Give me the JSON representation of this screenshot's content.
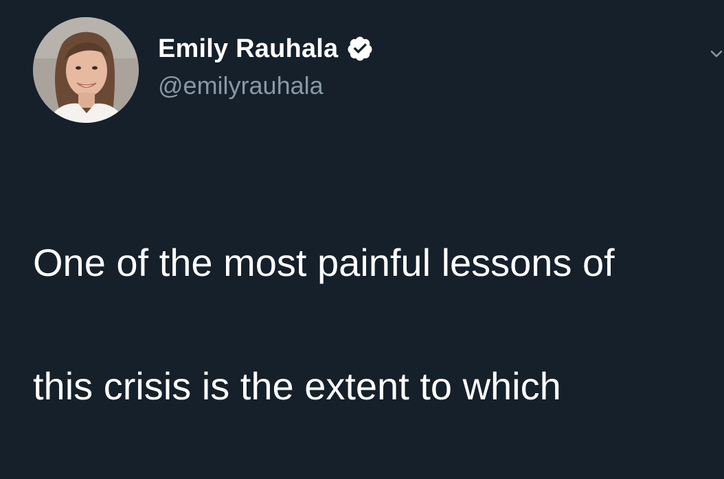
{
  "tweet": {
    "author": {
      "display_name": "Emily Rauhala",
      "handle": "@emilyrauhala",
      "verified": true,
      "avatar_icon": "profile-photo"
    },
    "text_line_1": "One of the most painful lessons of",
    "text_line_2": "this crisis is the extent to which"
  },
  "colors": {
    "background": "#15202b",
    "primary_text": "#ffffff",
    "secondary_text": "#8899a6",
    "verified_badge": "#ffffff"
  }
}
